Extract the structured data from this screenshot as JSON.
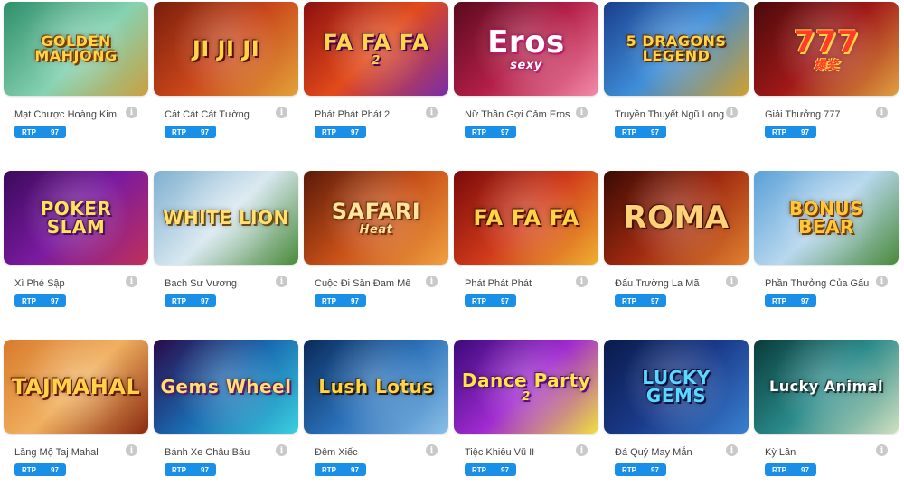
{
  "rtp_label": "RTP",
  "games": [
    {
      "thumb_title": "GOLDEN MAHJONG",
      "thumb_sub": "",
      "name": "Mạt Chược Hoàng Kim",
      "rtp": "97",
      "bg": "linear-gradient(135deg,#2e8f6a,#86d2b2 55%,#c9a040)",
      "fg": "#ffd447",
      "shadow": "#7a3c00"
    },
    {
      "thumb_title": "JI JI JI",
      "thumb_sub": "",
      "name": "Cát Cát Cát Tường",
      "rtp": "97",
      "bg": "linear-gradient(135deg,#7a1e0c,#c9461a 50%,#e3a23a)",
      "fg": "#ffd64a",
      "shadow": "#5a0d00"
    },
    {
      "thumb_title": "FA FA FA",
      "thumb_sub": "2",
      "name": "Phát Phát Phát 2",
      "rtp": "97",
      "bg": "linear-gradient(135deg,#8c1010,#e24a1a 50%,#7a2ca8)",
      "fg": "#ffd447",
      "shadow": "#4a0060"
    },
    {
      "thumb_title": "Eros",
      "thumb_sub": "sexy",
      "name": "Nữ Thần Gợi Cảm Eros",
      "rtp": "97",
      "bg": "linear-gradient(135deg,#5a0a1e,#b21e48 50%,#f48aa8)",
      "fg": "#ffffff",
      "shadow": "#c0186a"
    },
    {
      "thumb_title": "5 DRAGONS LEGEND",
      "thumb_sub": "",
      "name": "Truyền Thuyết Ngũ Long",
      "rtp": "97",
      "bg": "linear-gradient(135deg,#1a3e8c,#3f8ed8 50%,#d0a030)",
      "fg": "#ffd447",
      "shadow": "#5a2a00"
    },
    {
      "thumb_title": "777",
      "thumb_sub": "爆奖",
      "name": "Giải Thưởng 777",
      "rtp": "97",
      "bg": "linear-gradient(135deg,#4a0a0a,#a01818 50%,#e0a040)",
      "fg": "#ff3b2a",
      "shadow": "#ffd447"
    },
    {
      "thumb_title": "POKER SLAM",
      "thumb_sub": "",
      "name": "Xì Phé Sập",
      "rtp": "97",
      "bg": "linear-gradient(135deg,#3a0a5a,#7a1aa0 50%,#c0305a)",
      "fg": "#ffe15a",
      "shadow": "#4a1060"
    },
    {
      "thumb_title": "WHITE LION",
      "thumb_sub": "",
      "name": "Bạch Sư Vương",
      "rtp": "97",
      "bg": "linear-gradient(135deg,#7fb0d0,#d8e8f0 50%,#4a8a3a)",
      "fg": "#ffe070",
      "shadow": "#6a4a10"
    },
    {
      "thumb_title": "SAFARI",
      "thumb_sub": "Heat",
      "name": "Cuộc Đi Săn Đam Mê",
      "rtp": "97",
      "bg": "linear-gradient(135deg,#5a1a08,#c85018 50%,#f0a040)",
      "fg": "#ffe6a0",
      "shadow": "#7a2a00"
    },
    {
      "thumb_title": "FA FA FA",
      "thumb_sub": "",
      "name": "Phát Phát Phát",
      "rtp": "97",
      "bg": "linear-gradient(135deg,#7a0a0a,#d03a1a 50%,#f0b030)",
      "fg": "#ffd447",
      "shadow": "#5a1000"
    },
    {
      "thumb_title": "ROMA",
      "thumb_sub": "",
      "name": "Đấu Trường La Mã",
      "rtp": "97",
      "bg": "linear-gradient(135deg,#3a0a04,#a02a10 50%,#e08030)",
      "fg": "#ffd27a",
      "shadow": "#4a1000"
    },
    {
      "thumb_title": "BONUS BEAR",
      "thumb_sub": "",
      "name": "Phần Thưởng Của Gấu",
      "rtp": "97",
      "bg": "linear-gradient(135deg,#5aa0d8,#b8d8ee 50%,#4a8a3a)",
      "fg": "#ffc83a",
      "shadow": "#7a3a00"
    },
    {
      "thumb_title": "TAJMAHAL",
      "thumb_sub": "",
      "name": "Lăng Mộ Taj Mahal",
      "rtp": "97",
      "bg": "linear-gradient(135deg,#d87a2a,#f0b060 50%,#8a2a10)",
      "fg": "#ffd24a",
      "shadow": "#6a1a00"
    },
    {
      "thumb_title": "Gems Wheel",
      "thumb_sub": "",
      "name": "Bánh Xe Châu Báu",
      "rtp": "97",
      "bg": "linear-gradient(135deg,#2a0a4a,#1a6ab0 50%,#3ad0e0)",
      "fg": "#ffe070",
      "shadow": "#5a1a6a"
    },
    {
      "thumb_title": "Lush Lotus",
      "thumb_sub": "",
      "name": "Đêm Xiếc",
      "rtp": "97",
      "bg": "linear-gradient(135deg,#0a2a5a,#2a70b8 50%,#8ac0e8)",
      "fg": "#ffd447",
      "shadow": "#2a1a00"
    },
    {
      "thumb_title": "Dance Party",
      "thumb_sub": "2",
      "name": "Tiệc Khiêu Vũ II",
      "rtp": "97",
      "bg": "linear-gradient(135deg,#3a0a7a,#a02ad0 50%,#f0e040)",
      "fg": "#ffe640",
      "shadow": "#5a0a8a"
    },
    {
      "thumb_title": "LUCKY GEMS",
      "thumb_sub": "",
      "name": "Đá Quý May Mắn",
      "rtp": "97",
      "bg": "linear-gradient(135deg,#0a1a4a,#1a3a8a 50%,#3a80d0)",
      "fg": "#5ad8ff",
      "shadow": "#0a1040"
    },
    {
      "thumb_title": "Lucky Animal",
      "thumb_sub": "",
      "name": "Kỳ Lân",
      "rtp": "97",
      "bg": "linear-gradient(135deg,#0a3a3a,#2a8a8a 50%,#d0e0c0)",
      "fg": "#ffffff",
      "shadow": "#1a3a3a"
    }
  ]
}
